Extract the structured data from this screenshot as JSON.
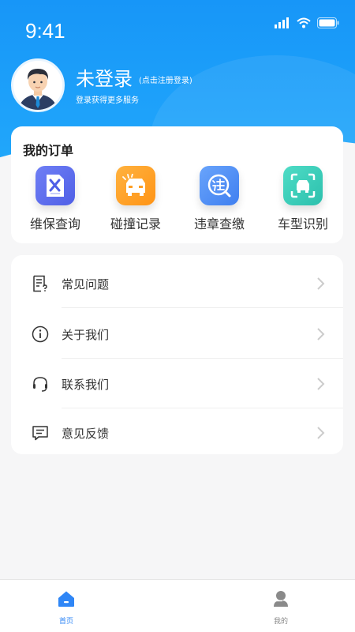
{
  "status_bar": {
    "time": "9:41"
  },
  "profile": {
    "title": "未登录",
    "hint": "(点击注册登录)",
    "subtitle": "登录获得更多服务"
  },
  "orders": {
    "title": "我的订单",
    "items": [
      {
        "label": "维保查询",
        "icon": "maintenance-icon",
        "color": "#5b6cf0"
      },
      {
        "label": "碰撞记录",
        "icon": "collision-car-icon",
        "color": "#ffa12b"
      },
      {
        "label": "违章查缴",
        "icon": "violation-icon",
        "color": "#4f8ef5"
      },
      {
        "label": "车型识别",
        "icon": "car-scan-icon",
        "color": "#36c9b6"
      }
    ]
  },
  "menu": {
    "items": [
      {
        "label": "常见问题",
        "icon": "faq-icon"
      },
      {
        "label": "关于我们",
        "icon": "info-icon"
      },
      {
        "label": "联系我们",
        "icon": "headset-icon"
      },
      {
        "label": "意见反馈",
        "icon": "feedback-icon"
      }
    ]
  },
  "tabbar": {
    "items": [
      {
        "label": "首页",
        "icon": "home-icon",
        "active": true
      },
      {
        "label": "我的",
        "icon": "user-icon",
        "active": false
      }
    ],
    "active_color": "#2f86f6",
    "inactive_color": "#8a8a8a"
  },
  "colors": {
    "header": "#1796f8",
    "background": "#f6f6f7"
  }
}
